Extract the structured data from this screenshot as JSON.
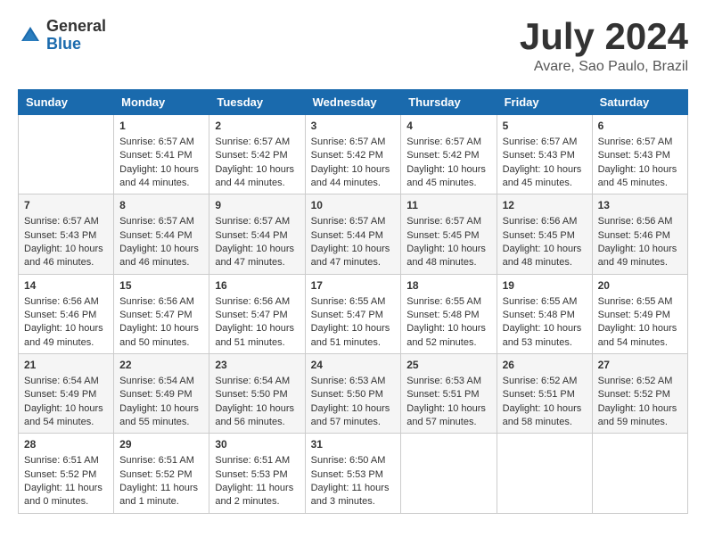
{
  "header": {
    "logo_general": "General",
    "logo_blue": "Blue",
    "month_title": "July 2024",
    "location": "Avare, Sao Paulo, Brazil"
  },
  "weekdays": [
    "Sunday",
    "Monday",
    "Tuesday",
    "Wednesday",
    "Thursday",
    "Friday",
    "Saturday"
  ],
  "weeks": [
    [
      {
        "day": null,
        "content": null
      },
      {
        "day": "1",
        "sunrise": "6:57 AM",
        "sunset": "5:41 PM",
        "daylight": "10 hours and 44 minutes."
      },
      {
        "day": "2",
        "sunrise": "6:57 AM",
        "sunset": "5:42 PM",
        "daylight": "10 hours and 44 minutes."
      },
      {
        "day": "3",
        "sunrise": "6:57 AM",
        "sunset": "5:42 PM",
        "daylight": "10 hours and 44 minutes."
      },
      {
        "day": "4",
        "sunrise": "6:57 AM",
        "sunset": "5:42 PM",
        "daylight": "10 hours and 45 minutes."
      },
      {
        "day": "5",
        "sunrise": "6:57 AM",
        "sunset": "5:43 PM",
        "daylight": "10 hours and 45 minutes."
      },
      {
        "day": "6",
        "sunrise": "6:57 AM",
        "sunset": "5:43 PM",
        "daylight": "10 hours and 45 minutes."
      }
    ],
    [
      {
        "day": "7",
        "sunrise": "6:57 AM",
        "sunset": "5:43 PM",
        "daylight": "10 hours and 46 minutes."
      },
      {
        "day": "8",
        "sunrise": "6:57 AM",
        "sunset": "5:44 PM",
        "daylight": "10 hours and 46 minutes."
      },
      {
        "day": "9",
        "sunrise": "6:57 AM",
        "sunset": "5:44 PM",
        "daylight": "10 hours and 47 minutes."
      },
      {
        "day": "10",
        "sunrise": "6:57 AM",
        "sunset": "5:44 PM",
        "daylight": "10 hours and 47 minutes."
      },
      {
        "day": "11",
        "sunrise": "6:57 AM",
        "sunset": "5:45 PM",
        "daylight": "10 hours and 48 minutes."
      },
      {
        "day": "12",
        "sunrise": "6:56 AM",
        "sunset": "5:45 PM",
        "daylight": "10 hours and 48 minutes."
      },
      {
        "day": "13",
        "sunrise": "6:56 AM",
        "sunset": "5:46 PM",
        "daylight": "10 hours and 49 minutes."
      }
    ],
    [
      {
        "day": "14",
        "sunrise": "6:56 AM",
        "sunset": "5:46 PM",
        "daylight": "10 hours and 49 minutes."
      },
      {
        "day": "15",
        "sunrise": "6:56 AM",
        "sunset": "5:47 PM",
        "daylight": "10 hours and 50 minutes."
      },
      {
        "day": "16",
        "sunrise": "6:56 AM",
        "sunset": "5:47 PM",
        "daylight": "10 hours and 51 minutes."
      },
      {
        "day": "17",
        "sunrise": "6:55 AM",
        "sunset": "5:47 PM",
        "daylight": "10 hours and 51 minutes."
      },
      {
        "day": "18",
        "sunrise": "6:55 AM",
        "sunset": "5:48 PM",
        "daylight": "10 hours and 52 minutes."
      },
      {
        "day": "19",
        "sunrise": "6:55 AM",
        "sunset": "5:48 PM",
        "daylight": "10 hours and 53 minutes."
      },
      {
        "day": "20",
        "sunrise": "6:55 AM",
        "sunset": "5:49 PM",
        "daylight": "10 hours and 54 minutes."
      }
    ],
    [
      {
        "day": "21",
        "sunrise": "6:54 AM",
        "sunset": "5:49 PM",
        "daylight": "10 hours and 54 minutes."
      },
      {
        "day": "22",
        "sunrise": "6:54 AM",
        "sunset": "5:49 PM",
        "daylight": "10 hours and 55 minutes."
      },
      {
        "day": "23",
        "sunrise": "6:54 AM",
        "sunset": "5:50 PM",
        "daylight": "10 hours and 56 minutes."
      },
      {
        "day": "24",
        "sunrise": "6:53 AM",
        "sunset": "5:50 PM",
        "daylight": "10 hours and 57 minutes."
      },
      {
        "day": "25",
        "sunrise": "6:53 AM",
        "sunset": "5:51 PM",
        "daylight": "10 hours and 57 minutes."
      },
      {
        "day": "26",
        "sunrise": "6:52 AM",
        "sunset": "5:51 PM",
        "daylight": "10 hours and 58 minutes."
      },
      {
        "day": "27",
        "sunrise": "6:52 AM",
        "sunset": "5:52 PM",
        "daylight": "10 hours and 59 minutes."
      }
    ],
    [
      {
        "day": "28",
        "sunrise": "6:51 AM",
        "sunset": "5:52 PM",
        "daylight": "11 hours and 0 minutes."
      },
      {
        "day": "29",
        "sunrise": "6:51 AM",
        "sunset": "5:52 PM",
        "daylight": "11 hours and 1 minute."
      },
      {
        "day": "30",
        "sunrise": "6:51 AM",
        "sunset": "5:53 PM",
        "daylight": "11 hours and 2 minutes."
      },
      {
        "day": "31",
        "sunrise": "6:50 AM",
        "sunset": "5:53 PM",
        "daylight": "11 hours and 3 minutes."
      },
      {
        "day": null,
        "content": null
      },
      {
        "day": null,
        "content": null
      },
      {
        "day": null,
        "content": null
      }
    ]
  ],
  "labels": {
    "sunrise_prefix": "Sunrise: ",
    "sunset_prefix": "Sunset: ",
    "daylight_prefix": "Daylight: "
  }
}
